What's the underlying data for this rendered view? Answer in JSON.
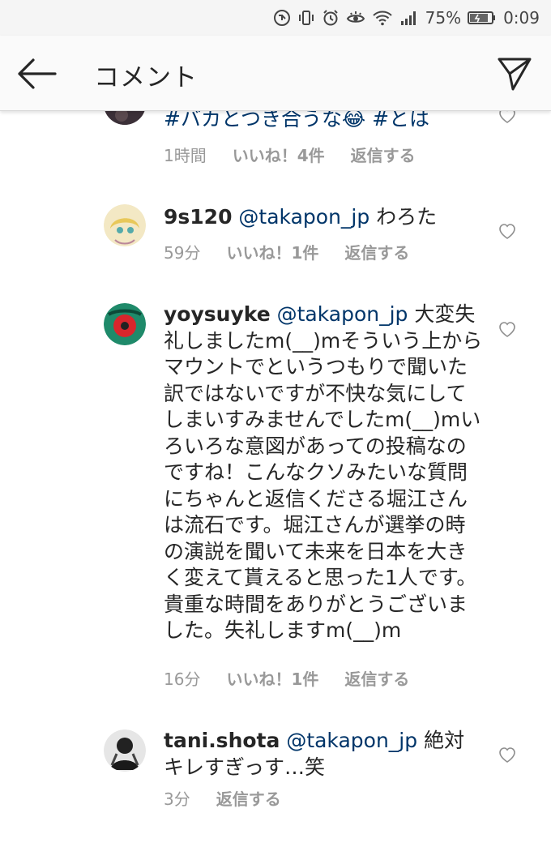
{
  "status_bar": {
    "battery": "75%",
    "time": "0:09"
  },
  "header": {
    "title": "コメント"
  },
  "comments": [
    {
      "text": "#バカとつき合うな😂 #とは",
      "time": "1時間",
      "likes": "いいね！4件",
      "reply": "返信する"
    },
    {
      "username": "9s120",
      "mention": "@takapon_jp",
      "text": " わろた",
      "time": "59分",
      "likes": "いいね！1件",
      "reply": "返信する"
    },
    {
      "username": "yoysuyke",
      "mention": "@takapon_jp",
      "text": " 大変失礼しましたm(__)mそういう上からマウントでというつもりで聞いた訳ではないですが不快な気にしてしまいすみませんでしたm(__)mいろいろな意図があっての投稿なのですね！こんなクソみたいな質問にちゃんと返信くださる堀江さんは流石です。堀江さんが選挙の時の演説を聞いて未来を日本を大きく変えて貰えると思った1人です。貴重な時間をありがとうございました。失礼しますm(__)m",
      "time": "16分",
      "likes": "いいね！1件",
      "reply": "返信する"
    },
    {
      "username": "tani.shota",
      "mention": "@takapon_jp",
      "text": " 絶対キレすぎっす…笑",
      "time": "3分",
      "reply": "返信する"
    }
  ],
  "colors": {
    "mention": "#003569",
    "meta": "#999999",
    "header_bg": "#fafafa",
    "status_bg": "#f5f5f5"
  }
}
